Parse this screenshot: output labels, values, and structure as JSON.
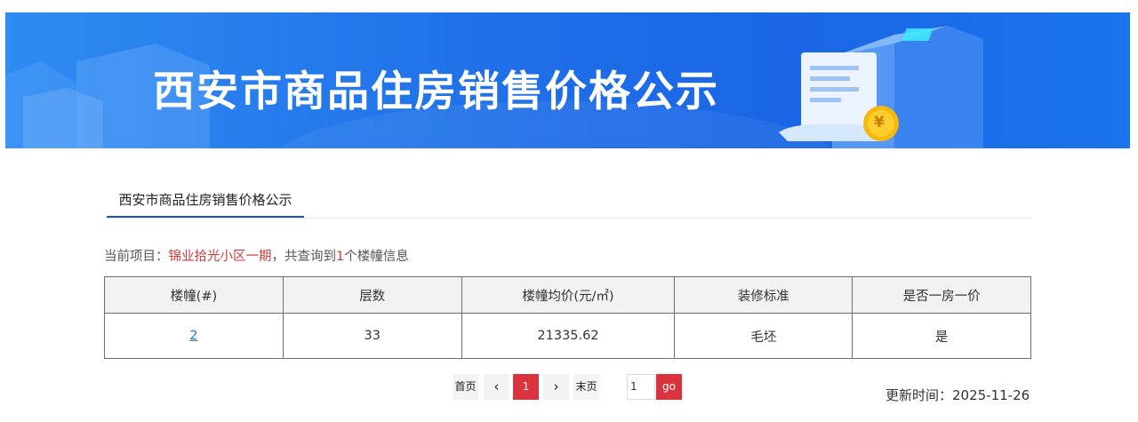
{
  "banner": {
    "title": "西安市商品住房销售价格公示",
    "coin_symbol": "¥"
  },
  "tabs": [
    {
      "label": "西安市商品住房销售价格公示"
    }
  ],
  "info": {
    "prefix": "当前项目：",
    "project": "锦业拾光小区一期",
    "middle": "，共查询到",
    "count": "1",
    "suffix": "个楼幢信息"
  },
  "table": {
    "headers": [
      "楼幢(#)",
      "层数",
      "楼幢均价(元/㎡)",
      "装修标准",
      "是否一房一价"
    ],
    "rows": [
      [
        "2",
        "33",
        "21335.62",
        "毛坯",
        "是"
      ]
    ]
  },
  "pagination": {
    "first": "首页",
    "prev": "‹",
    "current": "1",
    "next": "›",
    "last": "末页",
    "page_input": "1",
    "go": "go"
  },
  "updated": "更新时间：2025-11-26",
  "colors": {
    "accent_red": "#d9343e",
    "banner_blue": "#1f6fe8",
    "tab_underline": "#1f4fb5",
    "link_blue": "#2a6fc9"
  }
}
